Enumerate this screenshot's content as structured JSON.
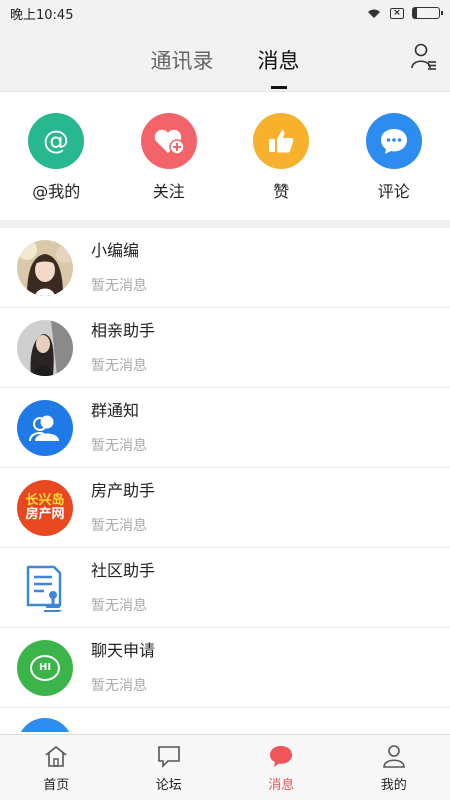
{
  "status_bar": {
    "time": "晚上10:45"
  },
  "header": {
    "tabs": [
      {
        "label": "通讯录",
        "active": false
      },
      {
        "label": "消息",
        "active": true
      }
    ]
  },
  "quick_actions": [
    {
      "label": "@我的",
      "icon": "at-icon",
      "color": "#27b88f"
    },
    {
      "label": "关注",
      "icon": "heart-plus-icon",
      "color": "#f3646a"
    },
    {
      "label": "赞",
      "icon": "thumbs-up-icon",
      "color": "#f7b12c"
    },
    {
      "label": "评论",
      "icon": "comment-icon",
      "color": "#2d8cf0"
    }
  ],
  "messages": [
    {
      "title": "小编编",
      "subtitle": "暂无消息",
      "avatar": "girl-photo-avatar"
    },
    {
      "title": "相亲助手",
      "subtitle": "暂无消息",
      "avatar": "woman-photo-avatar"
    },
    {
      "title": "群通知",
      "subtitle": "暂无消息",
      "avatar": "group-icon",
      "color": "#1f7ae8"
    },
    {
      "title": "房产助手",
      "subtitle": "暂无消息",
      "avatar": "house-logo",
      "logo_text_1": "长兴岛",
      "logo_text_2": "房产网",
      "color": "#e8471f"
    },
    {
      "title": "社区助手",
      "subtitle": "暂无消息",
      "avatar": "document-stamp-icon",
      "color": "#3f86d6"
    },
    {
      "title": "聊天申请",
      "subtitle": "暂无消息",
      "avatar": "chat-hi-icon",
      "badge_text": "HI",
      "color": "#3bb54a"
    }
  ],
  "tabbar": [
    {
      "label": "首页",
      "icon": "home-icon",
      "active": false
    },
    {
      "label": "论坛",
      "icon": "forum-icon",
      "active": false
    },
    {
      "label": "消息",
      "icon": "message-icon",
      "active": true,
      "color": "#f0555a"
    },
    {
      "label": "我的",
      "icon": "profile-icon",
      "active": false
    }
  ]
}
